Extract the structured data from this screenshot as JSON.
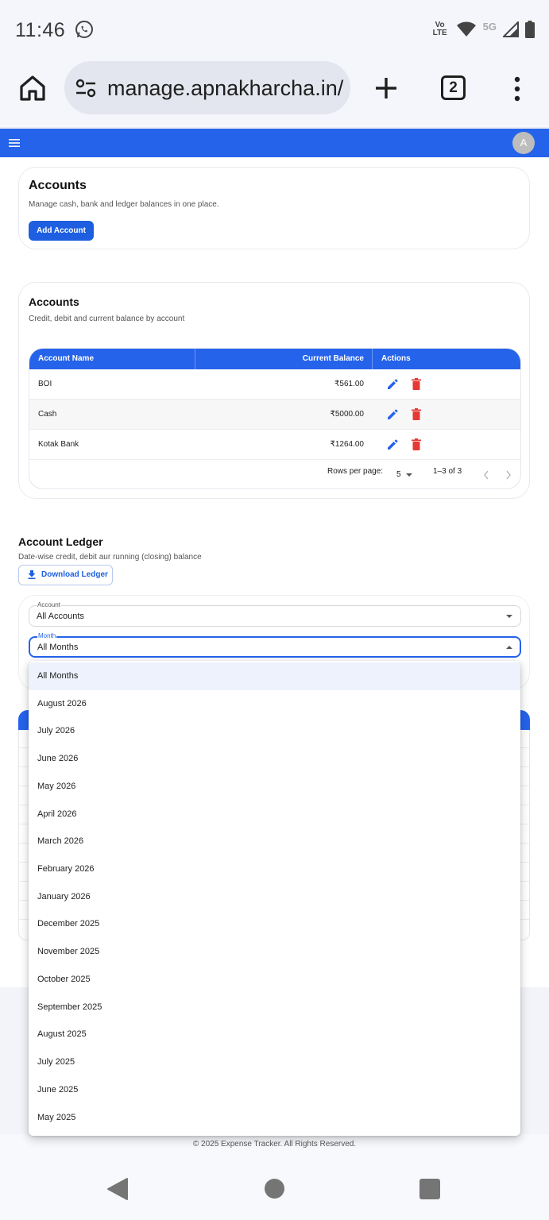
{
  "status_bar": {
    "time": "11:46",
    "network_volte": "Vo LTE",
    "network_5g": "5G",
    "icons": [
      "whatsapp-icon",
      "wifi-icon",
      "signal-icon",
      "battery-icon"
    ]
  },
  "browser": {
    "url": "manage.apnakharcha.in/",
    "tab_count": "2",
    "icons": [
      "home-icon",
      "site-settings-icon",
      "new-tab-icon",
      "more-icon"
    ]
  },
  "app_bar": {
    "avatar_initial": "A",
    "brand_color": "#2563eb"
  },
  "accounts_header": {
    "title": "Accounts",
    "subtitle": "Manage cash, bank and ledger balances in one place.",
    "add_button": "Add Account"
  },
  "accounts_table": {
    "title": "Accounts",
    "subtitle": "Credit, debit and current balance by account",
    "columns": [
      "Account Name",
      "Current Balance",
      "Actions"
    ],
    "rows": [
      {
        "name": "BOI",
        "balance": "₹561.00"
      },
      {
        "name": "Cash",
        "balance": "₹5000.00"
      },
      {
        "name": "Kotak Bank",
        "balance": "₹1264.00"
      }
    ],
    "rows_per_page_label": "Rows per page:",
    "rows_per_page": "5",
    "range": "1–3 of 3",
    "edit_color": "#2563eb",
    "delete_color": "#e53935"
  },
  "ledger": {
    "title": "Account Ledger",
    "subtitle": "Date-wise credit, debit aur running (closing) balance",
    "download_button": "Download Ledger",
    "account_field": {
      "label": "Account",
      "value": "All Accounts"
    },
    "month_field": {
      "label": "Month",
      "value": "All Months"
    }
  },
  "month_menu": {
    "options": [
      "All Months",
      "August 2026",
      "July 2026",
      "June 2026",
      "May 2026",
      "April 2026",
      "March 2026",
      "February 2026",
      "January 2026",
      "December 2025",
      "November 2025",
      "October 2025",
      "September 2025",
      "August 2025",
      "July 2025",
      "June 2025",
      "May 2025"
    ],
    "selected": "All Months"
  },
  "footer": {
    "text": "© 2025 Expense Tracker. All Rights Reserved."
  }
}
